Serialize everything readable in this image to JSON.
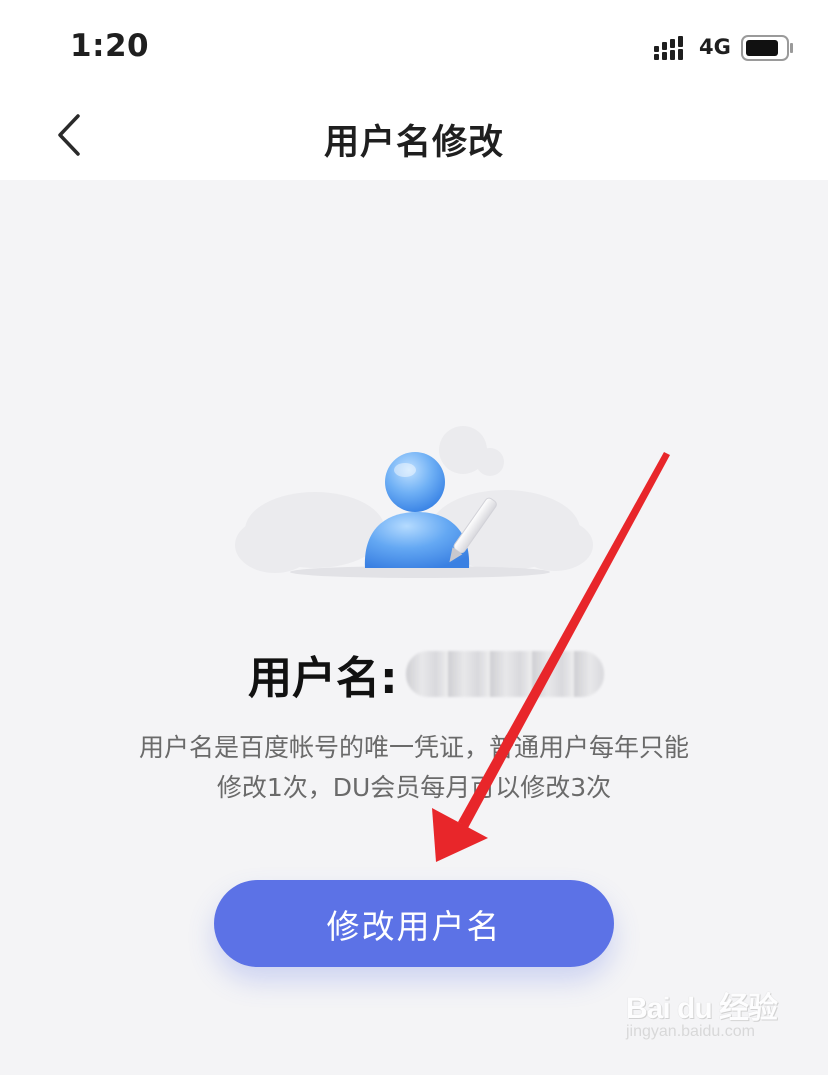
{
  "status_bar": {
    "time": "1:20",
    "network": "4G"
  },
  "nav": {
    "title": "用户名修改"
  },
  "profile": {
    "username_label": "用户名:",
    "description_line1": "用户名是百度帐号的唯一凭证，普通用户每年只能",
    "description_line2": "修改1次，DU会员每月可以修改3次"
  },
  "actions": {
    "change_button": "修改用户名"
  },
  "watermark": {
    "logo": "Bai du 经验",
    "url": "jingyan.baidu.com"
  },
  "colors": {
    "accent": "#5c72e6",
    "annotation_arrow": "#e8262a",
    "background": "#f4f4f6"
  }
}
